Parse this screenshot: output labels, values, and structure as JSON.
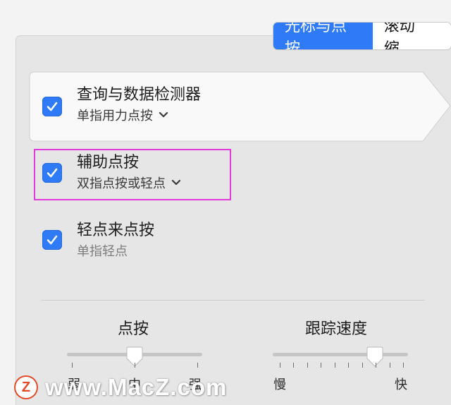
{
  "tabs": [
    {
      "label": "光标与点按",
      "active": true
    },
    {
      "label": "滚动缩",
      "active": false
    }
  ],
  "options": [
    {
      "title": "查询与数据检测器",
      "subtitle": "单指用力点按",
      "checked": true,
      "has_dropdown": true
    },
    {
      "title": "辅助点按",
      "subtitle": "双指点按或轻点",
      "checked": true,
      "has_dropdown": true
    },
    {
      "title": "轻点来点按",
      "subtitle": "单指轻点",
      "checked": true,
      "has_dropdown": false
    }
  ],
  "click_slider": {
    "title": "点按",
    "labels": [
      "弱",
      "中",
      "强"
    ],
    "value_position": 0.5
  },
  "tracking_slider": {
    "title": "跟踪速度",
    "labels": [
      "慢",
      "快"
    ],
    "value_position": 0.75
  },
  "watermark": {
    "text": "www.MacZ.com",
    "logo_letter": "Z"
  },
  "colors": {
    "accent": "#2f7af6",
    "highlight": "#e23ad8"
  }
}
